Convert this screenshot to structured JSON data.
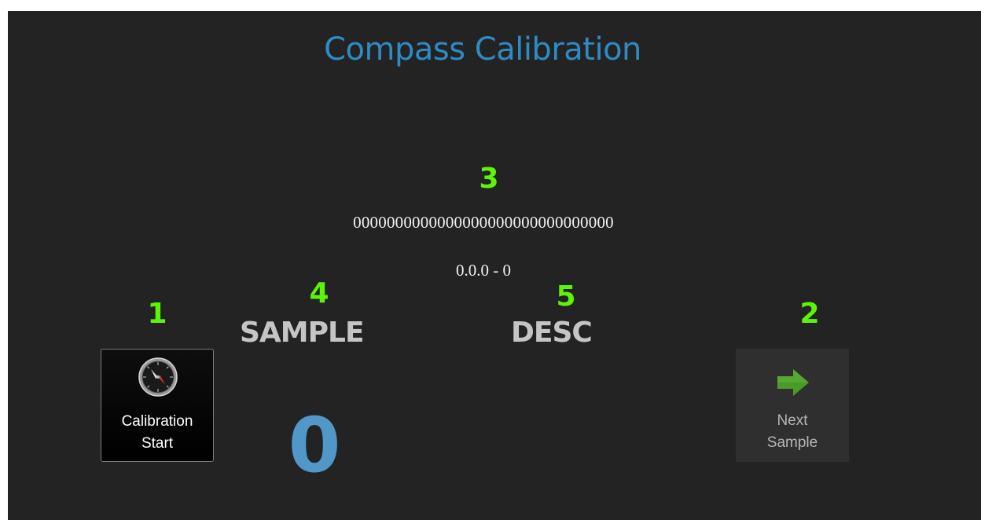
{
  "window": {
    "title": "Compass Calibration"
  },
  "markers": {
    "start": "1",
    "next": "2",
    "serial": "3",
    "sample": "4",
    "desc": "5"
  },
  "device": {
    "serial": "0000000000000000000000000000000",
    "version": "0.0.0 - 0"
  },
  "sample": {
    "heading": "SAMPLE",
    "count": "0"
  },
  "desc": {
    "heading": "DESC"
  },
  "buttons": {
    "calibration_start": {
      "line1": "Calibration",
      "line2": "Start",
      "icon": "compass-icon"
    },
    "next_sample": {
      "line1": "Next",
      "line2": "Sample",
      "icon": "arrow-right-icon"
    }
  },
  "colors": {
    "background": "#232323",
    "title": "#2e8bc3",
    "marker": "#5cf50a",
    "heading": "#c5c5c5",
    "count": "#5197c8",
    "arrow": "#4a9a2a"
  }
}
